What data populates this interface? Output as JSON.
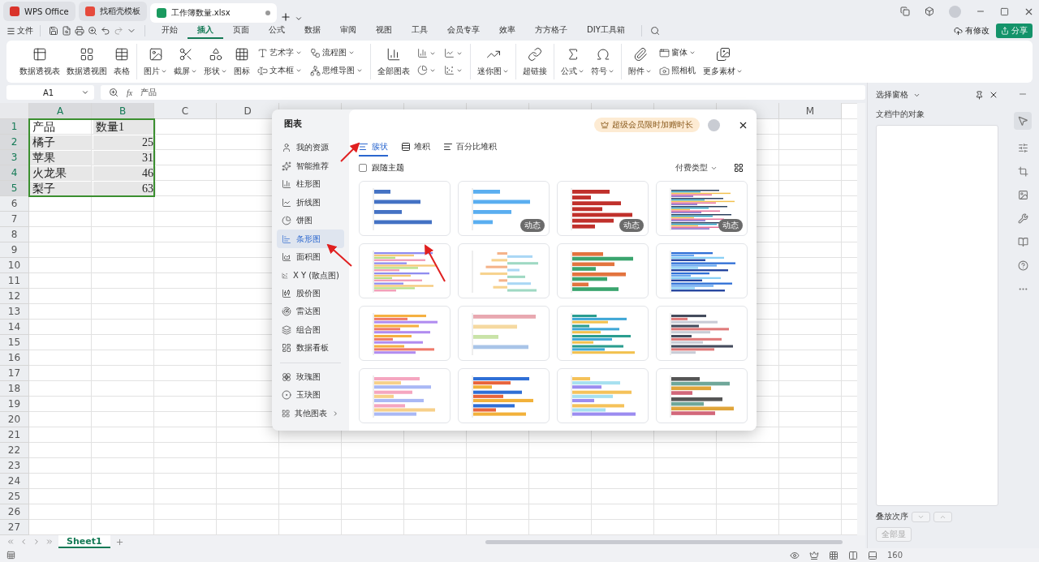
{
  "title_bar": {
    "tabs": [
      {
        "label": "WPS Office",
        "selected": false
      },
      {
        "label": "找稻壳模板",
        "selected": false
      },
      {
        "label": "工作簿数量.xlsx",
        "selected": true
      }
    ]
  },
  "menu": {
    "file": "文件",
    "tabs": [
      {
        "label": "开始",
        "selected": false
      },
      {
        "label": "插入",
        "selected": true
      },
      {
        "label": "页面",
        "selected": false
      },
      {
        "label": "公式",
        "selected": false
      },
      {
        "label": "数据",
        "selected": false
      },
      {
        "label": "审阅",
        "selected": false
      },
      {
        "label": "视图",
        "selected": false
      },
      {
        "label": "工具",
        "selected": false
      },
      {
        "label": "会员专享",
        "selected": false
      },
      {
        "label": "效率",
        "selected": false
      },
      {
        "label": "方方格子",
        "selected": false
      },
      {
        "label": "DIY工具箱",
        "selected": false
      }
    ],
    "cloud_status": "有修改",
    "share": "分享"
  },
  "ribbon": {
    "groups": [
      {
        "items": [
          {
            "kind": "large",
            "label": "数据透视表",
            "dropdown": false
          },
          {
            "kind": "large",
            "label": "数据透视图",
            "dropdown": false
          },
          {
            "kind": "large",
            "label": "表格",
            "dropdown": false
          }
        ]
      },
      {
        "items": [
          {
            "kind": "large",
            "label": "图片",
            "dropdown": true
          },
          {
            "kind": "large",
            "label": "截屏",
            "dropdown": true
          },
          {
            "kind": "large",
            "label": "形状",
            "dropdown": true
          },
          {
            "kind": "large",
            "label": "图标",
            "dropdown": false
          },
          {
            "kind": "stack",
            "rows": [
              {
                "label": "艺术字",
                "dropdown": true
              },
              {
                "label": "文本框",
                "dropdown": true
              }
            ]
          },
          {
            "kind": "stack",
            "rows": [
              {
                "label": "流程图",
                "dropdown": true
              },
              {
                "label": "思维导图",
                "dropdown": true
              }
            ]
          }
        ]
      },
      {
        "items": [
          {
            "kind": "large",
            "label": "全部图表",
            "dropdown": false
          },
          {
            "kind": "stack",
            "rows": [
              {
                "dropdown": true
              },
              {
                "dropdown": true
              }
            ]
          },
          {
            "kind": "stack",
            "rows": [
              {
                "dropdown": true
              },
              {
                "dropdown": true
              }
            ]
          }
        ]
      },
      {
        "items": [
          {
            "kind": "large",
            "label": "迷你图",
            "dropdown": true
          }
        ]
      },
      {
        "items": [
          {
            "kind": "large",
            "label": "超链接",
            "dropdown": false
          }
        ]
      },
      {
        "items": [
          {
            "kind": "large",
            "label": "公式",
            "dropdown": true
          },
          {
            "kind": "large",
            "label": "符号",
            "dropdown": true
          }
        ]
      },
      {
        "items": [
          {
            "kind": "large",
            "label": "附件",
            "dropdown": true
          },
          {
            "kind": "stack",
            "rows": [
              {
                "label": "窗体",
                "dropdown": true
              },
              {
                "label": "照相机",
                "dropdown": false
              }
            ]
          },
          {
            "kind": "large",
            "label": "更多素材",
            "dropdown": true
          }
        ]
      }
    ]
  },
  "formula_bar": {
    "name_box": "A1",
    "function_label": "fx",
    "formula": "产品"
  },
  "sheet": {
    "columns": [
      {
        "label": "A",
        "selected": true
      },
      {
        "label": "B",
        "selected": true
      },
      {
        "label": "C",
        "selected": false
      },
      {
        "label": "D",
        "selected": false
      },
      {
        "selected": false
      },
      {
        "selected": false
      },
      {
        "selected": false
      },
      {
        "selected": false
      },
      {
        "selected": false
      },
      {
        "selected": false
      },
      {
        "selected": false
      },
      {
        "selected": false
      },
      {
        "label": "M",
        "selected": false
      }
    ],
    "rows": [
      {
        "label": "1",
        "selected": true,
        "cells": [
          {
            "text": "产品",
            "kind": "text"
          },
          {
            "text": "数量1",
            "kind": "text"
          }
        ]
      },
      {
        "label": "2",
        "selected": true,
        "cells": [
          {
            "text": "橘子",
            "kind": "text"
          },
          {
            "text": "25",
            "kind": "number"
          }
        ]
      },
      {
        "label": "3",
        "selected": true,
        "cells": [
          {
            "text": "苹果",
            "kind": "text"
          },
          {
            "text": "31",
            "kind": "number"
          }
        ]
      },
      {
        "label": "4",
        "selected": true,
        "cells": [
          {
            "text": "火龙果",
            "kind": "text"
          },
          {
            "text": "46",
            "kind": "number"
          }
        ]
      },
      {
        "label": "5",
        "selected": true,
        "cells": [
          {
            "text": "梨子",
            "kind": "text"
          },
          {
            "text": "63",
            "kind": "number"
          }
        ]
      },
      {
        "label": "6",
        "selected": false,
        "cells": []
      },
      {
        "label": "7",
        "selected": false,
        "cells": []
      },
      {
        "label": "8",
        "selected": false,
        "cells": []
      },
      {
        "label": "9",
        "selected": false,
        "cells": []
      },
      {
        "label": "10",
        "selected": false,
        "cells": []
      },
      {
        "label": "11",
        "selected": false,
        "cells": []
      },
      {
        "label": "12",
        "selected": false,
        "cells": []
      },
      {
        "label": "13",
        "selected": false,
        "cells": []
      },
      {
        "label": "14",
        "selected": false,
        "cells": []
      },
      {
        "label": "15",
        "selected": false,
        "cells": []
      },
      {
        "label": "16",
        "selected": false,
        "cells": []
      },
      {
        "label": "17",
        "selected": false,
        "cells": []
      },
      {
        "label": "18",
        "selected": false,
        "cells": []
      },
      {
        "label": "19",
        "selected": false,
        "cells": []
      },
      {
        "label": "20",
        "selected": false,
        "cells": []
      },
      {
        "label": "21",
        "selected": false,
        "cells": []
      },
      {
        "label": "22",
        "selected": false,
        "cells": []
      },
      {
        "label": "23",
        "selected": false,
        "cells": []
      },
      {
        "label": "24",
        "selected": false,
        "cells": []
      },
      {
        "label": "25",
        "selected": false,
        "cells": []
      },
      {
        "label": "26",
        "selected": false,
        "cells": []
      },
      {
        "label": "27",
        "selected": false,
        "cells": []
      }
    ],
    "tabs": [
      {
        "label": "Sheet1",
        "selected": true
      }
    ]
  },
  "selection_pane": {
    "title": "选择窗格",
    "subtitle": "文档中的对象",
    "order_label": "叠放次序",
    "show_all": "全部显"
  },
  "status_bar": {
    "zoom": "160"
  },
  "chart_dialog": {
    "title": "图表",
    "promo": "超级会员限时加赠时长",
    "nav_groups": [
      [
        {
          "label": "我的资源",
          "selected": false,
          "expandable": false
        },
        {
          "label": "智能推荐",
          "selected": false,
          "expandable": false
        },
        {
          "label": "柱形图",
          "selected": false,
          "expandable": false
        },
        {
          "label": "折线图",
          "selected": false,
          "expandable": false
        },
        {
          "label": "饼图",
          "selected": false,
          "expandable": false
        },
        {
          "label": "条形图",
          "selected": true,
          "expandable": false
        },
        {
          "label": "面积图",
          "selected": false,
          "expandable": false
        },
        {
          "label": "X Y (散点图)",
          "selected": false,
          "expandable": false
        },
        {
          "label": "股价图",
          "selected": false,
          "expandable": false
        },
        {
          "label": "雷达图",
          "selected": false,
          "expandable": false
        },
        {
          "label": "组合图",
          "selected": false,
          "expandable": false
        },
        {
          "label": "数据看板",
          "selected": false,
          "expandable": false
        }
      ],
      [
        {
          "label": "玫瑰图",
          "selected": false,
          "expandable": false
        },
        {
          "label": "玉玦图",
          "selected": false,
          "expandable": false
        },
        {
          "label": "其他图表",
          "selected": false,
          "expandable": true
        }
      ]
    ],
    "tabs": [
      {
        "label": "簇状",
        "selected": true
      },
      {
        "label": "堆积",
        "selected": false
      },
      {
        "label": "百分比堆积",
        "selected": false
      }
    ],
    "follow_theme": {
      "label": "跟随主题",
      "checked": false
    },
    "filter": "付费类型",
    "thumbnails": [
      {
        "kind": "plain"
      },
      {
        "kind": "light",
        "badge": "动态"
      },
      {
        "kind": "red",
        "badge": "动态"
      },
      {
        "kind": "grouped",
        "badge": "动态"
      },
      {
        "kind": "pastel"
      },
      {
        "kind": "diverging"
      },
      {
        "kind": "pictogram"
      },
      {
        "kind": "blue-group"
      },
      {
        "kind": "warm"
      },
      {
        "kind": "wide"
      },
      {
        "kind": "teal"
      },
      {
        "kind": "dark"
      },
      {
        "kind": "soft"
      },
      {
        "kind": "blue-orange"
      },
      {
        "kind": "gradient"
      },
      {
        "kind": "dark-gold"
      }
    ]
  }
}
